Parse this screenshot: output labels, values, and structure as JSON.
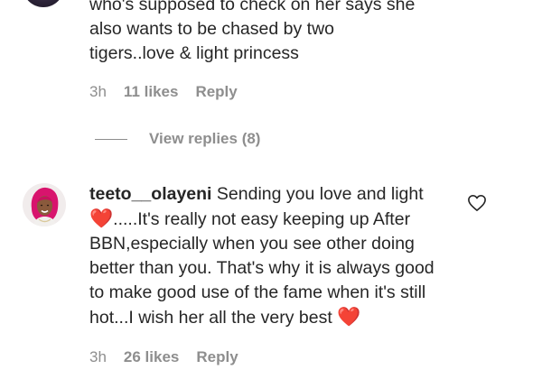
{
  "comment1": {
    "text_lines": [
      "who's supposed to check on her says she",
      "also wants to be chased by two",
      "tigers..love & light princess"
    ],
    "time": "3h",
    "likes": "11 likes",
    "reply": "Reply",
    "view_replies": "View replies (8)"
  },
  "comment2": {
    "username": "teeto__olayeni",
    "text_part1": " Sending you love and light ",
    "text_part2": ".....It's really not easy keeping up After BBN,especially when you see other doing better than you. That's why it is always good to make good use of the fame when it's still hot...I wish her all the very best ",
    "heart_emoji": "❤️",
    "time": "3h",
    "likes": "26 likes",
    "reply": "Reply"
  },
  "colors": {
    "text": "#262626",
    "muted": "#8e8e8e",
    "heart": "#e0162b"
  },
  "icons": {
    "like": "heart-outline-icon"
  }
}
